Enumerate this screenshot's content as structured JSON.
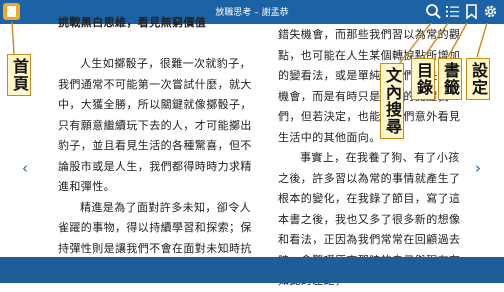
{
  "header": {
    "title": "放職思考 – 謝孟恭",
    "icons": [
      "home-icon",
      "search-icon",
      "toc-icon",
      "bookmark-icon",
      "settings-icon"
    ]
  },
  "book": {
    "left_heading": "挑戰黑白思維，看見無窮價值",
    "left_paragraphs": [
      "人生如擲骰子，很難一次就豹子，我們通常不可能第一次嘗試什麼，就大中，大獲全勝，所以關鍵就像擲骰子，只有願意繼續玩下去的人，才可能擲出豹子，並且看見生活的各種驚喜，但不論股市或是人生，我們都得時時力求精進和彈性。",
      "精進是為了面對許多未知，卻令人雀躍的事物，得以持續學習和探索；保持彈性則是讓我們不會在面對未知時抗"
    ],
    "right_paragraphs": [
      "錯失機會，而那些我們習以為常的觀點，也可能在人生某個轉捩點所增加的變看法，或是單純讓我們錯失其他機會，而是有時只是不腦的提醒我們，但若決定，也能讓我們意外看見生活中的其他面向。",
      "事實上，在我養了狗、有了小孩之後，許多習以為常的事情就產生了根本的變化，在我錄了節目，寫了這本書之後，我也又多了很多新的想像和看法，正因為我們常常在回顧過去時，會驚嘆原來那時的自己與現在有如此的差距，"
    ]
  },
  "navigation": {
    "prev": "‹",
    "next": "›"
  },
  "callouts": {
    "home": "首頁",
    "search": "文內搜尋",
    "toc": "目錄",
    "bookmark": "書籤",
    "settings": "設定"
  },
  "colors": {
    "topbar": "#1b63a5",
    "bottombar": "#1d5e98",
    "callout_border": "#c98a1a",
    "callout_bg": "#fff7c8",
    "home_icon": "#f5a623"
  }
}
